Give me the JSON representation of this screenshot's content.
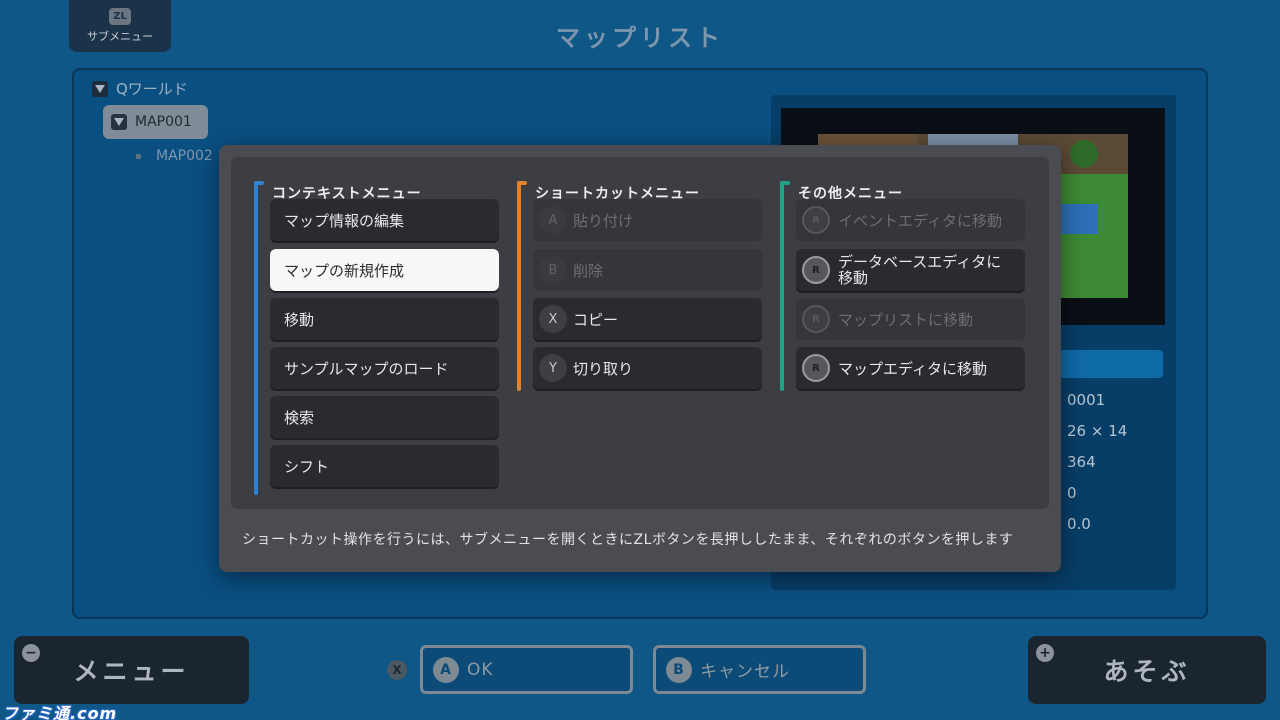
{
  "header": {
    "submenu_key": "ZL",
    "submenu_label": "サブメニュー",
    "title": "マップリスト"
  },
  "tree": {
    "root_label": "Qワールド",
    "items": [
      {
        "label": "MAP001",
        "selected": true
      },
      {
        "label": "MAP002",
        "selected": false
      }
    ]
  },
  "preview": {
    "stats": [
      "0001",
      "26 × 14",
      "364",
      "0",
      "0.0"
    ]
  },
  "dialog": {
    "columns": [
      {
        "title": "コンテキストメニュー",
        "accent": "#2f83d0",
        "items": [
          {
            "label": "マップ情報の編集"
          },
          {
            "label": "マップの新規作成",
            "selected": true
          },
          {
            "label": "移動"
          },
          {
            "label": "サンプルマップのロード"
          },
          {
            "label": "検索"
          },
          {
            "label": "シフト"
          }
        ]
      },
      {
        "title": "ショートカットメニュー",
        "accent": "#e2822a",
        "items": [
          {
            "key": "A",
            "label": "貼り付け",
            "disabled": true
          },
          {
            "key": "B",
            "label": "削除",
            "disabled": true
          },
          {
            "key": "X",
            "label": "コピー"
          },
          {
            "key": "Y",
            "label": "切り取り"
          }
        ]
      },
      {
        "title": "その他メニュー",
        "accent": "#1fa386",
        "items": [
          {
            "label": "イベントエディタに移動",
            "disabled": true,
            "icon": "r-stick-icon"
          },
          {
            "label": "データベースエディタに移動",
            "line1": "データベースエディタに",
            "line2": "移動",
            "icon": "r-stick-icon"
          },
          {
            "label": "マップリストに移動",
            "disabled": true,
            "icon": "r-stick-icon"
          },
          {
            "label": "マップエディタに移動",
            "icon": "r-stick-icon"
          }
        ]
      }
    ],
    "footer": "ショートカット操作を行うには、サブメニューを開くときにZLボタンを長押ししたまま、それぞれのボタンを押します"
  },
  "bottom": {
    "menu_symbol": "−",
    "menu_label": "メニュー",
    "x_glyph": "X",
    "ok_glyph": "A",
    "ok_label": "OK",
    "cancel_glyph": "B",
    "cancel_label": "キャンセル",
    "play_symbol": "+",
    "play_label": "あそぶ"
  },
  "watermark": "ファミ通.com"
}
